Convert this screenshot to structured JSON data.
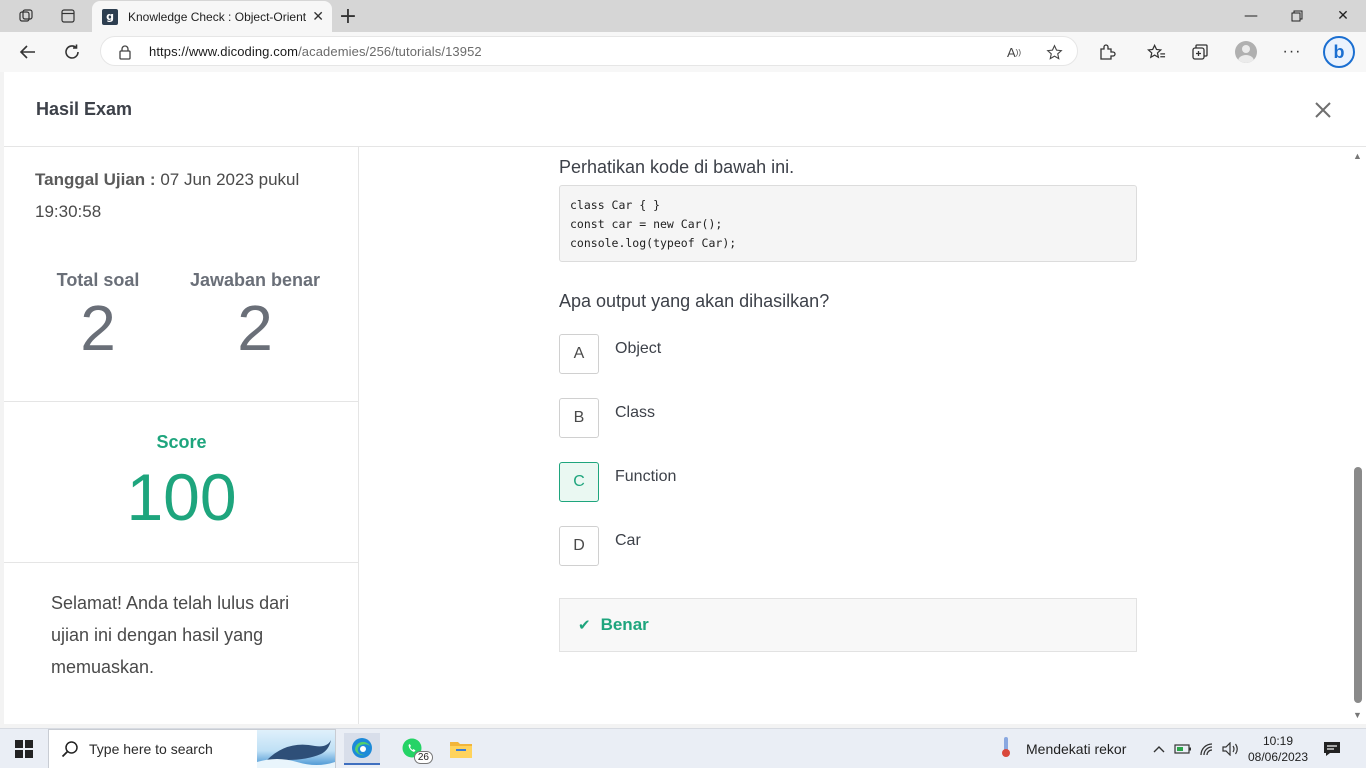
{
  "browser": {
    "tab_title": "Knowledge Check : Object-Orient",
    "url_domain": "https://www.dicoding.com",
    "url_path": "/academies/256/tutorials/13952",
    "favicon_letter": "g"
  },
  "modal": {
    "title": "Hasil Exam"
  },
  "summary": {
    "date_label": "Tanggal Ujian :",
    "date_value": "07 Jun 2023 pukul 19:30:58",
    "total_label": "Total soal",
    "total_value": "2",
    "correct_label": "Jawaban benar",
    "correct_value": "2",
    "score_label": "Score",
    "score_value": "100",
    "message": "Selamat! Anda telah lulus dari ujian ini dengan hasil yang memuaskan."
  },
  "question": {
    "intro": "Perhatikan kode di bawah ini.",
    "code": [
      "class Car { }",
      "const car = new Car();",
      "console.log(typeof Car);"
    ],
    "prompt": "Apa output yang akan dihasilkan?",
    "options": [
      {
        "letter": "A",
        "text": "Object",
        "selected": false
      },
      {
        "letter": "B",
        "text": "Class",
        "selected": false
      },
      {
        "letter": "C",
        "text": "Function",
        "selected": true
      },
      {
        "letter": "D",
        "text": "Car",
        "selected": false
      }
    ],
    "feedback": "Benar"
  },
  "taskbar": {
    "search_placeholder": "Type here to search",
    "whatsapp_badge": "26",
    "weather": "Mendekati rekor",
    "time": "10:19",
    "date": "08/06/2023"
  },
  "colors": {
    "accent_green": "#1ea57d",
    "text_gray": "#6a6f78"
  }
}
